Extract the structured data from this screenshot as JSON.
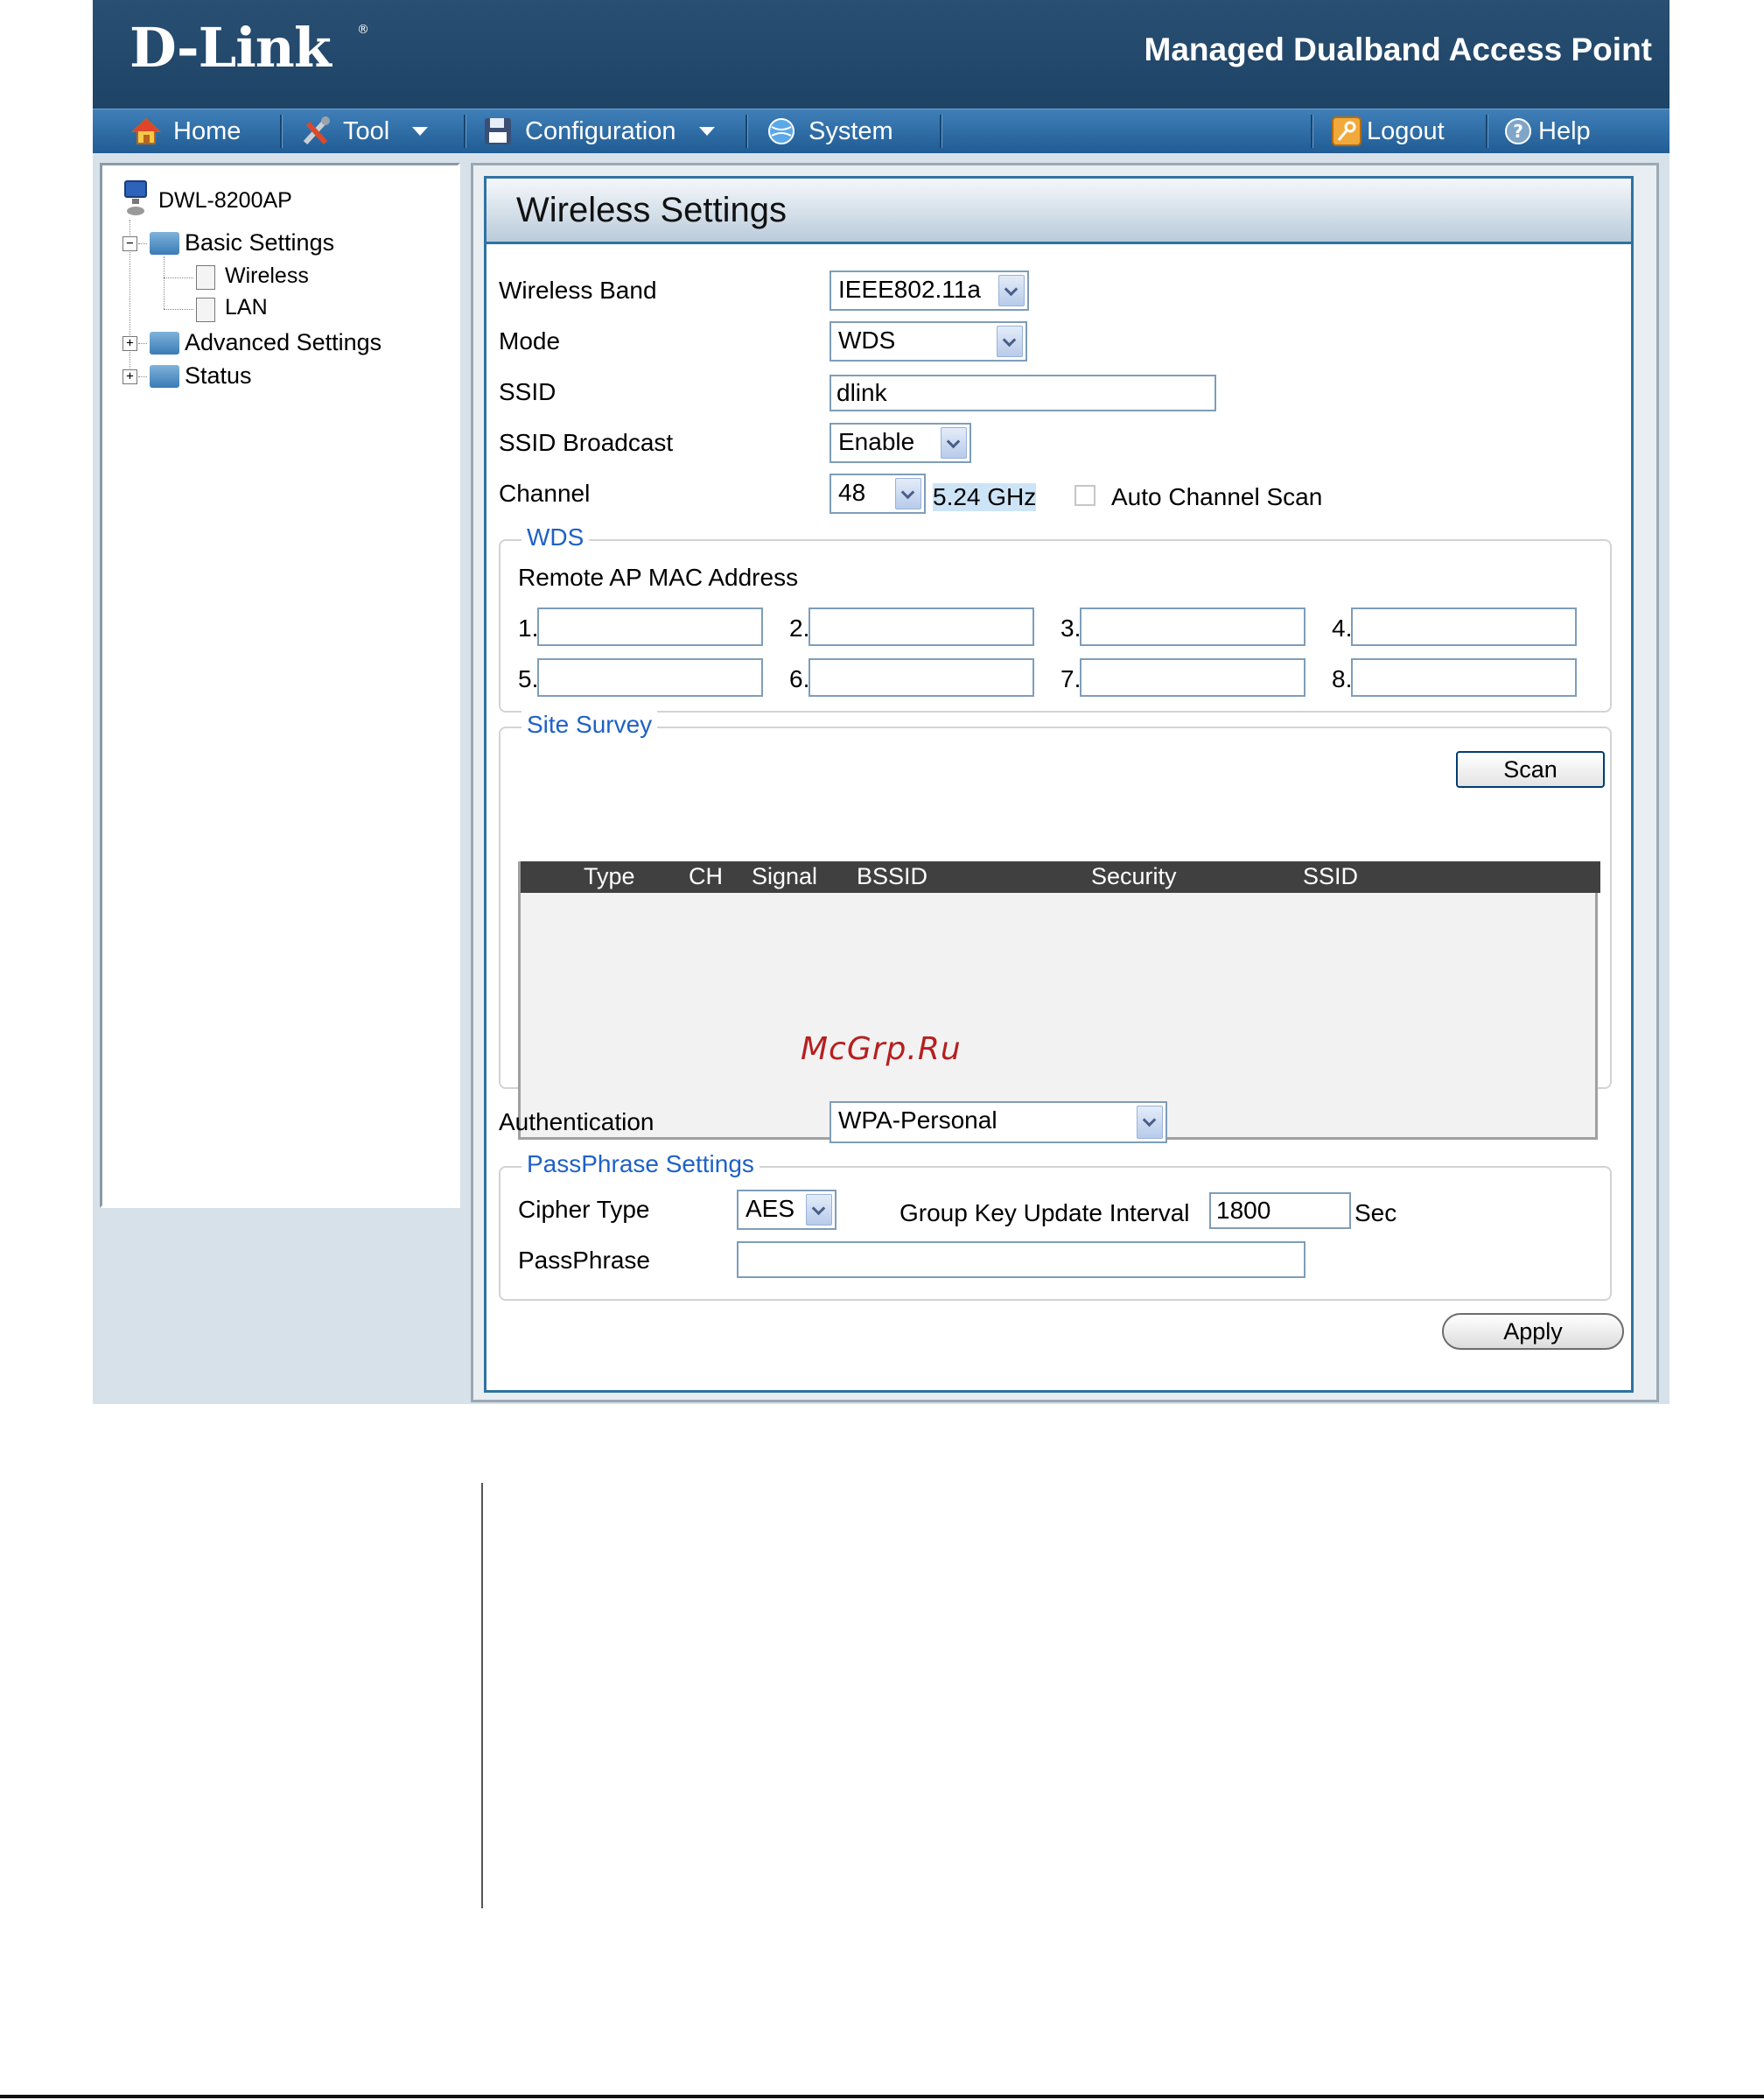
{
  "header": {
    "logo": "D-Link",
    "logo_reg": "®",
    "product": "Managed Dualband Access Point"
  },
  "menu": {
    "home": "Home",
    "tool": "Tool",
    "configuration": "Configuration",
    "system": "System",
    "logout": "Logout",
    "help": "Help"
  },
  "sidebar": {
    "device": "DWL-8200AP",
    "basic_settings": "Basic Settings",
    "wireless": "Wireless",
    "lan": "LAN",
    "advanced_settings": "Advanced Settings",
    "status": "Status",
    "expanded_symbol": "−",
    "collapsed_symbol": "+"
  },
  "page": {
    "title": "Wireless Settings"
  },
  "form": {
    "wireless_band_label": "Wireless Band",
    "wireless_band_value": "IEEE802.11a",
    "mode_label": "Mode",
    "mode_value": "WDS",
    "ssid_label": "SSID",
    "ssid_value": "dlink",
    "ssid_broadcast_label": "SSID Broadcast",
    "ssid_broadcast_value": "Enable",
    "channel_label": "Channel",
    "channel_value": "48",
    "channel_freq": "5.24 GHz",
    "auto_channel_scan_label": "Auto Channel Scan",
    "auto_channel_scan_checked": false,
    "authentication_label": "Authentication",
    "authentication_value": "WPA-Personal"
  },
  "wds": {
    "legend": "WDS",
    "remote_label": "Remote AP MAC Address",
    "entries": [
      {
        "num": "1.",
        "value": ""
      },
      {
        "num": "2.",
        "value": ""
      },
      {
        "num": "3.",
        "value": ""
      },
      {
        "num": "4.",
        "value": ""
      },
      {
        "num": "5.",
        "value": ""
      },
      {
        "num": "6.",
        "value": ""
      },
      {
        "num": "7.",
        "value": ""
      },
      {
        "num": "8.",
        "value": ""
      }
    ]
  },
  "site_survey": {
    "legend": "Site Survey",
    "scan_button": "Scan",
    "columns": [
      "Type",
      "CH",
      "Signal",
      "BSSID",
      "Security",
      "SSID"
    ],
    "rows": []
  },
  "passphrase": {
    "legend": "PassPhrase Settings",
    "cipher_label": "Cipher Type",
    "cipher_value": "AES",
    "group_key_label": "Group Key Update Interval",
    "group_key_value": "1800",
    "group_key_unit": "Sec",
    "passphrase_label": "PassPhrase",
    "passphrase_value": ""
  },
  "actions": {
    "apply": "Apply"
  },
  "watermark": "McGrp.Ru"
}
